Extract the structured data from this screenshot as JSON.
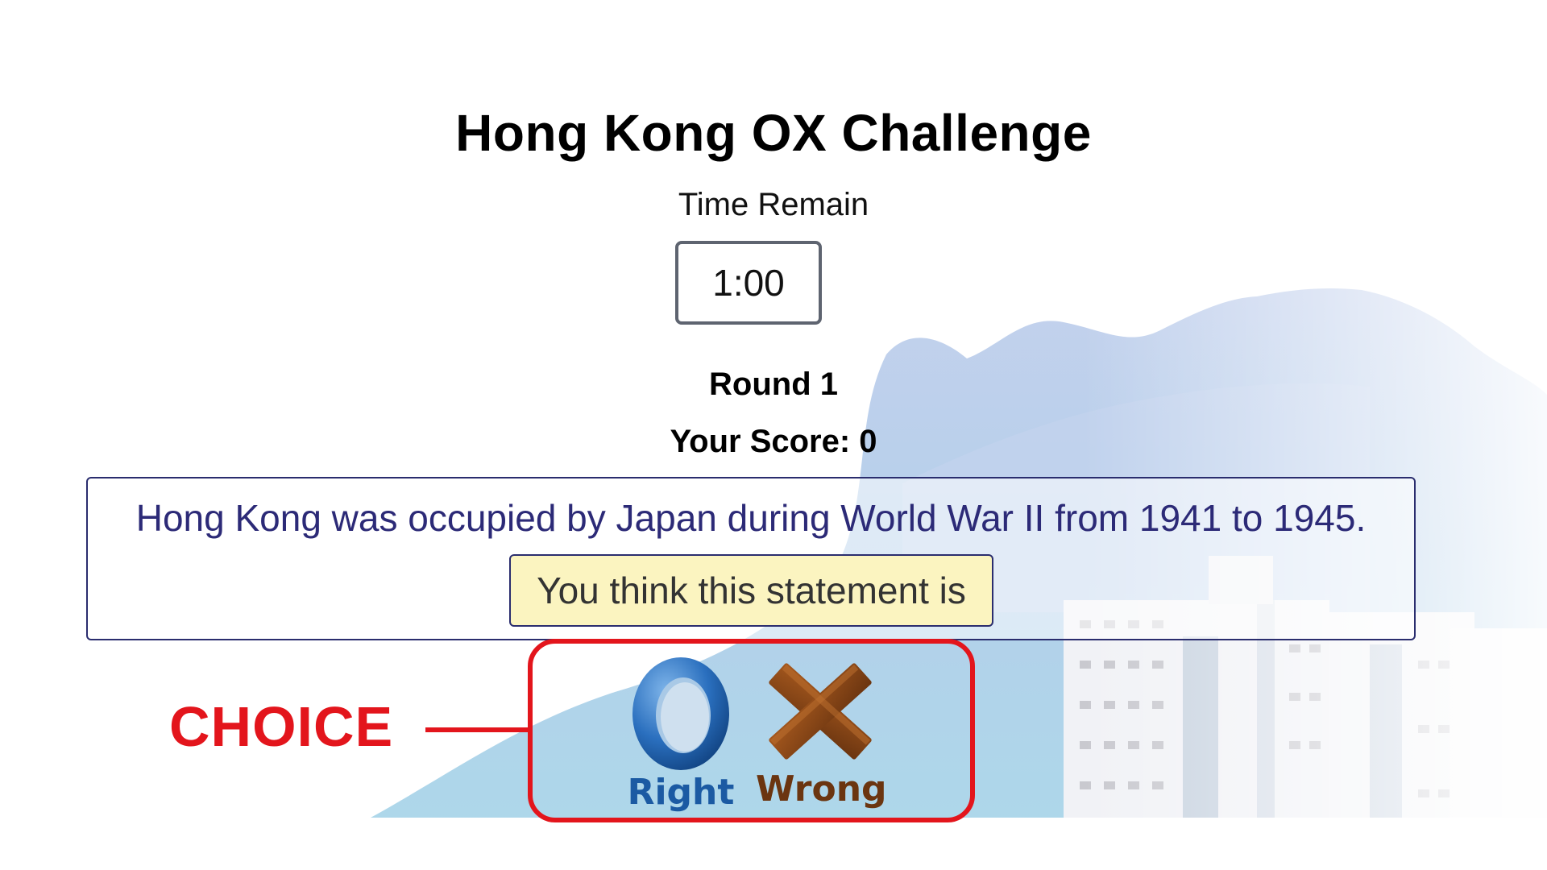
{
  "game": {
    "title": "Hong Kong OX Challenge",
    "time_label": "Time Remain",
    "timer_value": "1:00",
    "round_label": "Round 1",
    "score_line": "Your Score: 0"
  },
  "question": {
    "statement": "Hong Kong was occupied by Japan during World War II from 1941 to 1945.",
    "prompt": "You think this statement is"
  },
  "choices": {
    "right_label": "Right",
    "right_icon": "o-ring-icon",
    "wrong_label": "Wrong",
    "wrong_icon": "x-cross-icon"
  },
  "annotation": {
    "callout_label": "CHOICE",
    "callout_color": "#e3151c"
  },
  "colors": {
    "statement_text": "#2c2a77",
    "prompt_background": "#fbf4c0",
    "right_blue": "#1b5aa3",
    "wrong_brown": "#6b3510"
  }
}
